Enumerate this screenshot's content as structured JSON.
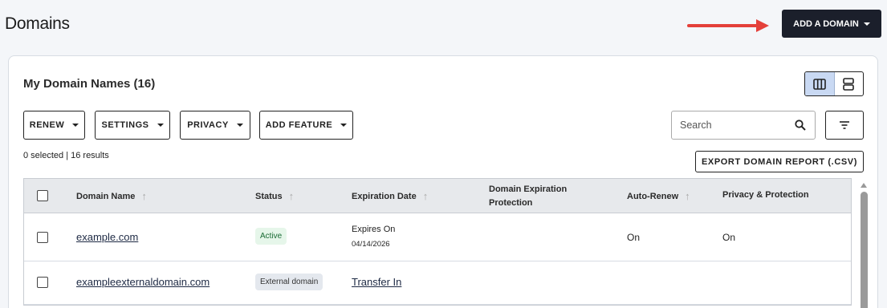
{
  "page": {
    "title": "Domains"
  },
  "header": {
    "add_domain_label": "ADD A DOMAIN"
  },
  "card": {
    "title": "My Domain Names (16)"
  },
  "toolbar": {
    "renew_label": "RENEW",
    "settings_label": "SETTINGS",
    "privacy_label": "PRIVACY",
    "add_feature_label": "ADD FEATURE",
    "search_placeholder": "Search",
    "export_label": "EXPORT DOMAIN REPORT (.CSV)"
  },
  "selection": {
    "text": "0 selected | 16 results"
  },
  "table": {
    "columns": {
      "domain": "Domain Name",
      "status": "Status",
      "expiration": "Expiration Date",
      "protection_line1": "Domain Expiration",
      "protection_line2": "Protection",
      "auto_renew": "Auto-Renew",
      "privacy": "Privacy & Protection"
    },
    "rows": [
      {
        "domain": "example.com",
        "status": "Active",
        "expires_label": "Expires On",
        "expires_date": "04/14/2026",
        "auto_renew": "On",
        "privacy": "On"
      },
      {
        "domain": "exampleexternaldomain.com",
        "status": "External domain",
        "action": "Transfer In"
      }
    ]
  },
  "colors": {
    "primary_button": "#1b1f2b",
    "arrow": "#e4403a",
    "active_badge_bg": "#e6f6ea",
    "view_active_bg": "#c9d9f3"
  }
}
